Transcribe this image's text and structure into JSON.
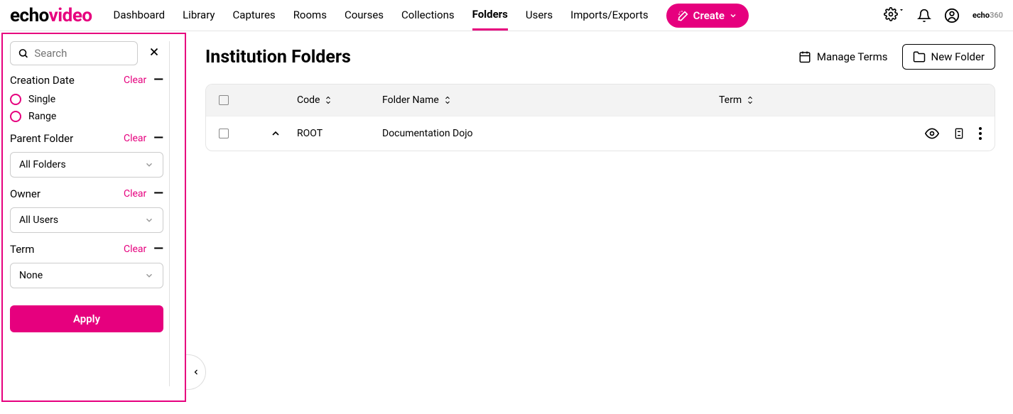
{
  "logo": {
    "left": "echo",
    "right": "video"
  },
  "nav": {
    "items": [
      "Dashboard",
      "Library",
      "Captures",
      "Rooms",
      "Courses",
      "Collections",
      "Folders",
      "Users",
      "Imports/Exports"
    ],
    "active": "Folders"
  },
  "create_button": "Create",
  "brand_small": {
    "left": "echo",
    "right": "360"
  },
  "sidebar": {
    "search_placeholder": "Search",
    "sections": {
      "creation_date": {
        "title": "Creation Date",
        "clear": "Clear",
        "options": [
          "Single",
          "Range"
        ]
      },
      "parent_folder": {
        "title": "Parent Folder",
        "clear": "Clear",
        "selected": "All Folders"
      },
      "owner": {
        "title": "Owner",
        "clear": "Clear",
        "selected": "All Users"
      },
      "term": {
        "title": "Term",
        "clear": "Clear",
        "selected": "None"
      }
    },
    "apply": "Apply"
  },
  "page": {
    "title": "Institution Folders",
    "manage_terms": "Manage Terms",
    "new_folder": "New Folder"
  },
  "table": {
    "headers": {
      "code": "Code",
      "folder_name": "Folder Name",
      "term": "Term"
    },
    "rows": [
      {
        "code": "ROOT",
        "folder_name": "Documentation Dojo",
        "term": ""
      }
    ]
  }
}
